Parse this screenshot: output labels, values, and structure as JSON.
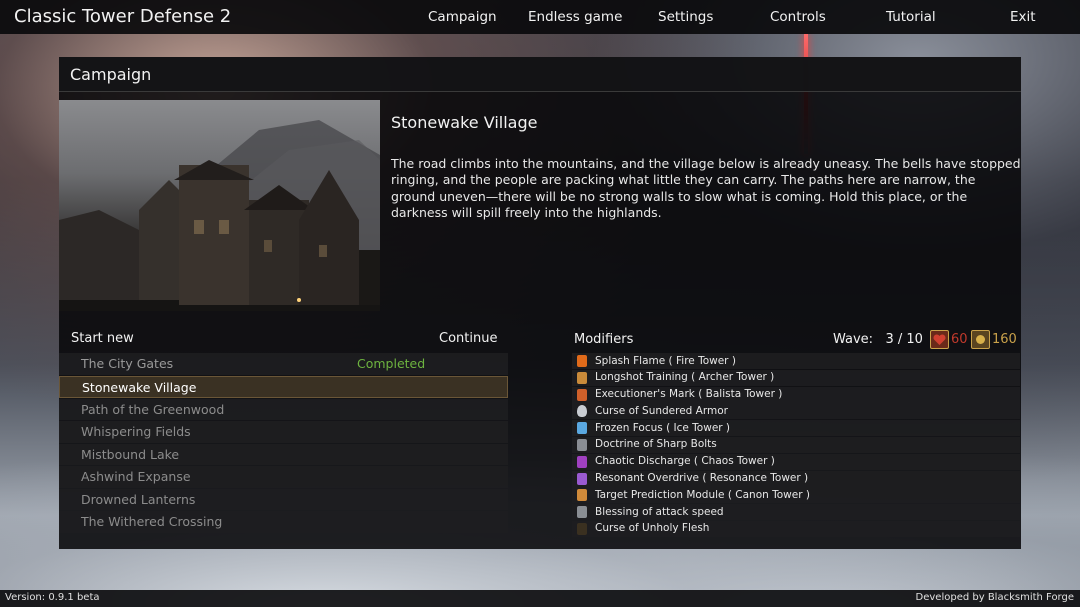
{
  "app": {
    "title": "Classic Tower Defense 2"
  },
  "menu": {
    "items": [
      {
        "label": "Campaign"
      },
      {
        "label": "Endless game"
      },
      {
        "label": "Settings"
      },
      {
        "label": "Controls"
      },
      {
        "label": "Tutorial"
      },
      {
        "label": "Exit"
      }
    ]
  },
  "panel": {
    "title": "Campaign"
  },
  "level": {
    "title": "Stonewake Village",
    "description": "The road climbs into the mountains, and the village below is already uneasy. The bells have stopped ringing, and the people are packing what little they can carry. The paths here are narrow, the ground uneven—there will be no strong walls to slow what is coming. Hold this place, or the darkness will spill freely into the highlands."
  },
  "list": {
    "start_new_label": "Start new",
    "continue_label": "Continue",
    "levels": [
      {
        "name": "The City Gates",
        "status": "Completed"
      },
      {
        "name": "Stonewake Village",
        "status": ""
      },
      {
        "name": "Path of the Greenwood",
        "status": ""
      },
      {
        "name": "Whispering Fields",
        "status": ""
      },
      {
        "name": "Mistbound Lake",
        "status": ""
      },
      {
        "name": "Ashwind Expanse",
        "status": ""
      },
      {
        "name": "Drowned Lanterns",
        "status": ""
      },
      {
        "name": "The Withered Crossing",
        "status": ""
      }
    ],
    "selected_index": 1
  },
  "stats": {
    "modifiers_label": "Modifiers",
    "wave_label": "Wave:",
    "wave_value": "3 / 10",
    "lives": "60",
    "gold": "160",
    "lives_color": "#c0392b",
    "gold_color": "#c9a14a"
  },
  "modifiers": [
    {
      "name": "Splash Flame ( Fire Tower )",
      "icon": "flame-icon",
      "color": "#e06a1a"
    },
    {
      "name": "Longshot Training ( Archer Tower )",
      "icon": "arrow-icon",
      "color": "#c98a3a"
    },
    {
      "name": "Executioner's Mark ( Balista Tower )",
      "icon": "mark-icon",
      "color": "#d0602a"
    },
    {
      "name": "Curse of Sundered Armor",
      "icon": "shield-icon",
      "color": "#c8ccd2"
    },
    {
      "name": "Frozen Focus ( Ice Tower )",
      "icon": "ice-icon",
      "color": "#5aa8e0"
    },
    {
      "name": "Doctrine of Sharp Bolts",
      "icon": "bolt-icon",
      "color": "#b8bcc2"
    },
    {
      "name": "Chaotic Discharge ( Chaos Tower )",
      "icon": "chaos-icon",
      "color": "#a040c0"
    },
    {
      "name": "Resonant Overdrive ( Resonance Tower )",
      "icon": "resonance-icon",
      "color": "#9a5ad0"
    },
    {
      "name": "Target Prediction Module ( Canon Tower )",
      "icon": "canon-icon",
      "color": "#d08a3a"
    },
    {
      "name": "Blessing of attack speed",
      "icon": "speed-icon",
      "color": "#c0c4ca"
    },
    {
      "name": "Curse of Unholy Flesh",
      "icon": "flesh-icon",
      "color": "#3a3020"
    }
  ],
  "footer": {
    "version": "Version: 0.9.1 beta",
    "developer": "Developed by Blacksmith Forge"
  }
}
